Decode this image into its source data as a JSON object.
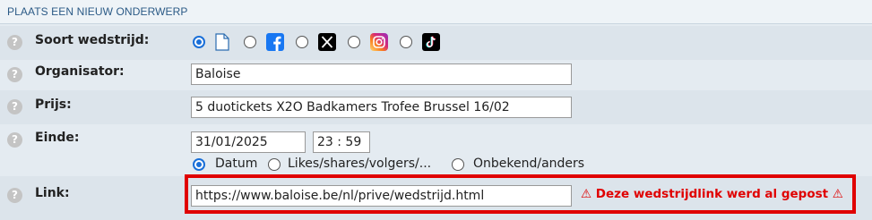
{
  "header": {
    "title": "PLAATS EEN NIEUW ONDERWERP"
  },
  "help_glyph": "?",
  "fields": {
    "soort": {
      "label": "Soort wedstrijd:",
      "options": [
        {
          "icon": "document-icon",
          "checked": true
        },
        {
          "icon": "facebook-icon",
          "checked": false
        },
        {
          "icon": "x-icon",
          "checked": false
        },
        {
          "icon": "instagram-icon",
          "checked": false
        },
        {
          "icon": "tiktok-icon",
          "checked": false
        }
      ]
    },
    "organisator": {
      "label": "Organisator:",
      "value": "Baloise"
    },
    "prijs": {
      "label": "Prijs:",
      "value": "5 duotickets X2O Badkamers Trofee Brussel 16/02"
    },
    "einde": {
      "label": "Einde:",
      "date": "31/01/2025",
      "time": "23 : 59",
      "options": [
        "Datum",
        "Likes/shares/volgers/...",
        "Onbekend/anders"
      ],
      "selected": "Datum"
    },
    "link": {
      "label": "Link:",
      "value": "https://www.baloise.be/nl/prive/wedstrijd.html",
      "warning": "⚠ Deze wedstrijdlink werd al gepost ⚠"
    }
  },
  "colors": {
    "accent": "#1a6fd8",
    "warning": "#e00000",
    "header_text": "#2b5a86",
    "facebook": "#1877f2"
  }
}
